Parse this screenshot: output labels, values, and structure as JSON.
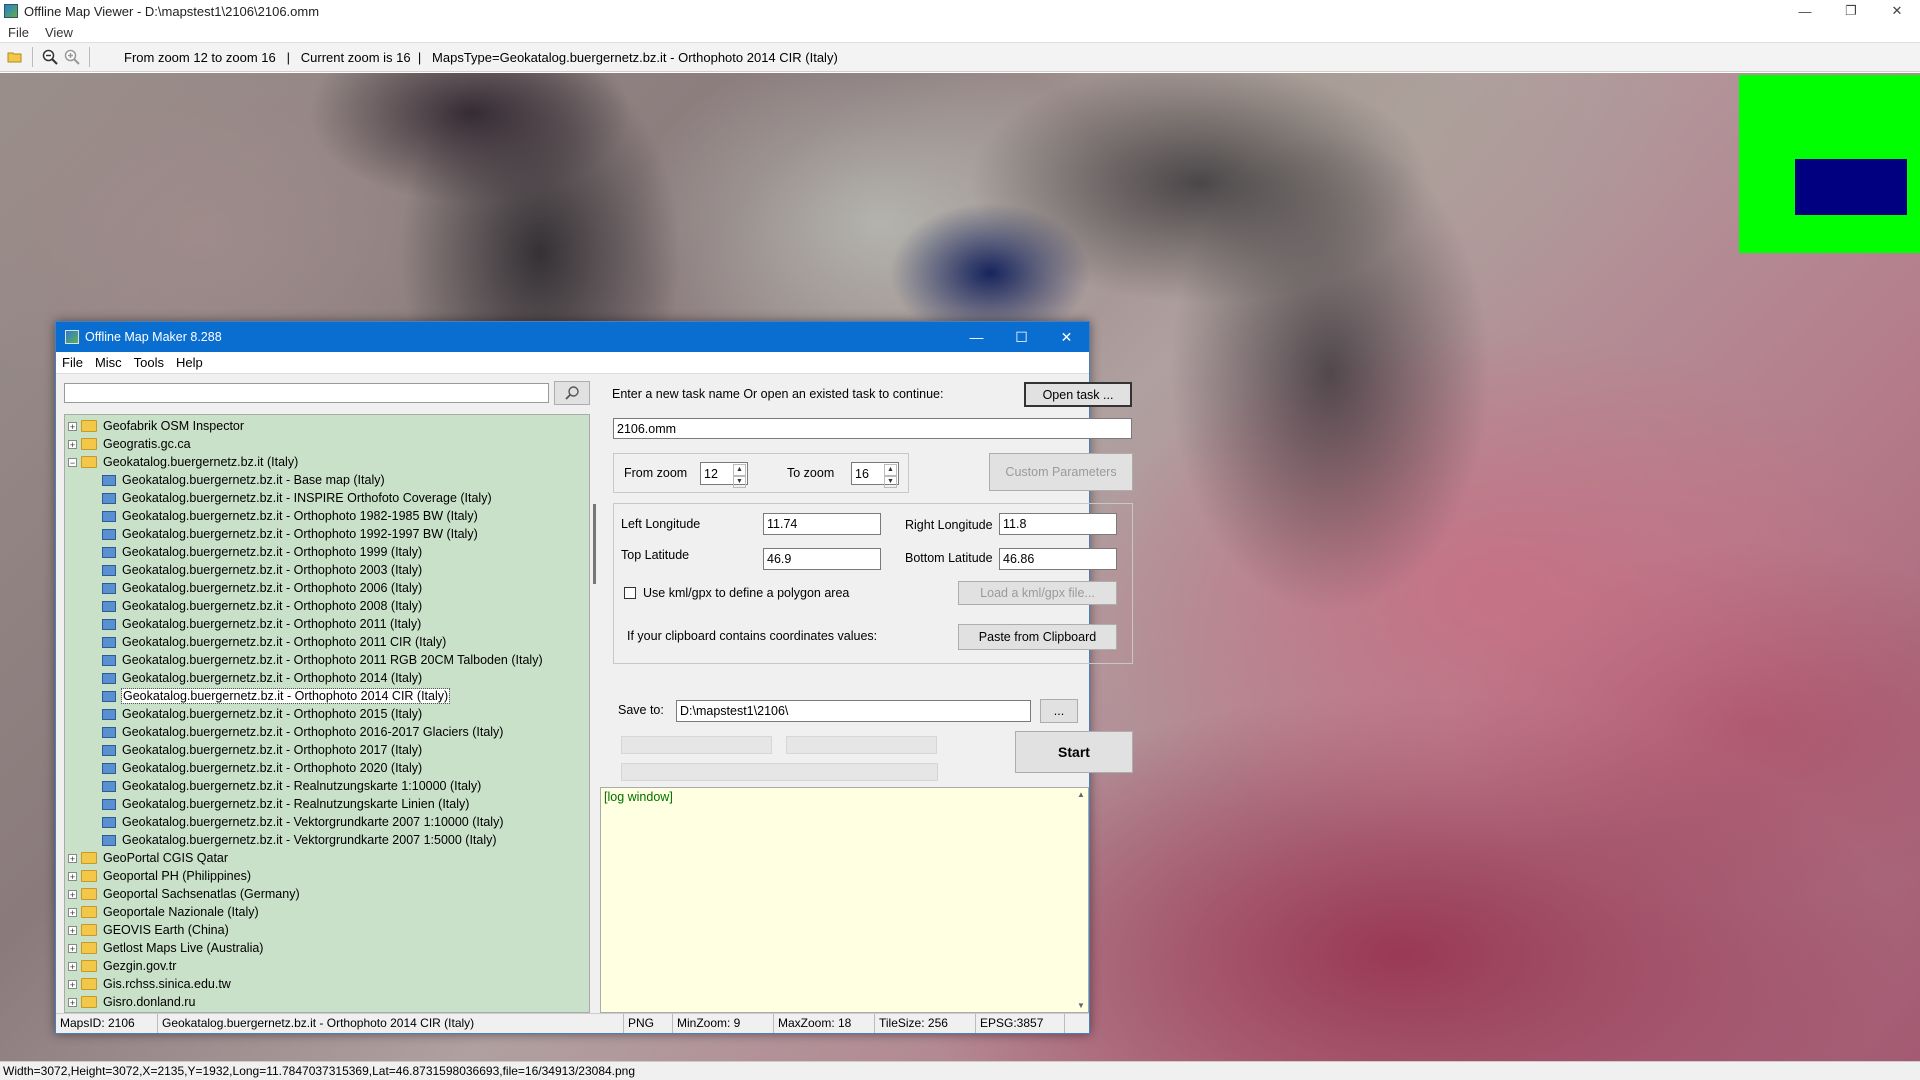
{
  "viewer": {
    "title": "Offline Map Viewer - D:\\mapstest1\\2106\\2106.omm",
    "menu": [
      "File",
      "View"
    ],
    "window_controls": [
      "—",
      "❐",
      "✕"
    ],
    "toolbar": {
      "status_text": "From zoom 12 to zoom 16   |   Current zoom is 16  |   MapsType=Geokatalog.buergernetz.bz.it - Orthophoto 2014 CIR (Italy)"
    },
    "statusbar": "Width=3072,Height=3072,X=2135,Y=1932,Long=11.7847037315369,Lat=46.8731598036693,file=16/34913/23084.png"
  },
  "colors": {
    "minimap_bg": "#00ff00",
    "minimap_view": "#000080",
    "dialog_title": "#0a6ed1",
    "tree_bg": "#c9e0c9",
    "log_bg": "#ffffe1"
  },
  "maker": {
    "title": "Offline Map Maker 8.288",
    "window_controls": [
      "—",
      "☐",
      "✕"
    ],
    "menu": [
      "File",
      "Misc",
      "Tools",
      "Help"
    ],
    "search": {
      "value": ""
    },
    "tree": [
      {
        "label": "Geofabrik OSM Inspector",
        "type": "folder",
        "expander": "+"
      },
      {
        "label": "Geogratis.gc.ca",
        "type": "folder",
        "expander": "+"
      },
      {
        "label": "Geokatalog.buergernetz.bz.it (Italy)",
        "type": "folder-open",
        "expander": "−"
      },
      {
        "label": "Geokatalog.buergernetz.bz.it - Base map (Italy)",
        "type": "map"
      },
      {
        "label": "Geokatalog.buergernetz.bz.it - INSPIRE Orthofoto Coverage (Italy)",
        "type": "map"
      },
      {
        "label": "Geokatalog.buergernetz.bz.it - Orthophoto 1982-1985 BW (Italy)",
        "type": "map"
      },
      {
        "label": "Geokatalog.buergernetz.bz.it - Orthophoto 1992-1997 BW (Italy)",
        "type": "map"
      },
      {
        "label": "Geokatalog.buergernetz.bz.it - Orthophoto 1999 (Italy)",
        "type": "map"
      },
      {
        "label": "Geokatalog.buergernetz.bz.it - Orthophoto 2003 (Italy)",
        "type": "map"
      },
      {
        "label": "Geokatalog.buergernetz.bz.it - Orthophoto 2006 (Italy)",
        "type": "map"
      },
      {
        "label": "Geokatalog.buergernetz.bz.it - Orthophoto 2008 (Italy)",
        "type": "map"
      },
      {
        "label": "Geokatalog.buergernetz.bz.it - Orthophoto 2011 (Italy)",
        "type": "map"
      },
      {
        "label": "Geokatalog.buergernetz.bz.it - Orthophoto 2011 CIR (Italy)",
        "type": "map"
      },
      {
        "label": "Geokatalog.buergernetz.bz.it - Orthophoto 2011 RGB 20CM Talboden (Italy)",
        "type": "map"
      },
      {
        "label": "Geokatalog.buergernetz.bz.it - Orthophoto 2014 (Italy)",
        "type": "map"
      },
      {
        "label": "Geokatalog.buergernetz.bz.it - Orthophoto 2014 CIR (Italy)",
        "type": "map",
        "selected": true
      },
      {
        "label": "Geokatalog.buergernetz.bz.it - Orthophoto 2015 (Italy)",
        "type": "map"
      },
      {
        "label": "Geokatalog.buergernetz.bz.it - Orthophoto 2016-2017 Glaciers (Italy)",
        "type": "map"
      },
      {
        "label": "Geokatalog.buergernetz.bz.it - Orthophoto 2017 (Italy)",
        "type": "map"
      },
      {
        "label": "Geokatalog.buergernetz.bz.it - Orthophoto 2020 (Italy)",
        "type": "map"
      },
      {
        "label": "Geokatalog.buergernetz.bz.it - Realnutzungskarte 1:10000 (Italy)",
        "type": "map"
      },
      {
        "label": "Geokatalog.buergernetz.bz.it - Realnutzungskarte Linien (Italy)",
        "type": "map"
      },
      {
        "label": "Geokatalog.buergernetz.bz.it - Vektorgrundkarte 2007 1:10000 (Italy)",
        "type": "map"
      },
      {
        "label": "Geokatalog.buergernetz.bz.it - Vektorgrundkarte 2007 1:5000 (Italy)",
        "type": "map"
      },
      {
        "label": "GeoPortal CGIS Qatar",
        "type": "folder",
        "expander": "+"
      },
      {
        "label": "Geoportal PH (Philippines)",
        "type": "folder",
        "expander": "+"
      },
      {
        "label": "Geoportal Sachsenatlas (Germany)",
        "type": "folder",
        "expander": "+"
      },
      {
        "label": "Geoportale Nazionale (Italy)",
        "type": "folder",
        "expander": "+"
      },
      {
        "label": "GEOVIS Earth (China)",
        "type": "folder",
        "expander": "+"
      },
      {
        "label": "Getlost Maps Live (Australia)",
        "type": "folder",
        "expander": "+"
      },
      {
        "label": "Gezgin.gov.tr",
        "type": "folder",
        "expander": "+"
      },
      {
        "label": "Gis.rchss.sinica.edu.tw",
        "type": "folder",
        "expander": "+"
      },
      {
        "label": "Gisro.donland.ru",
        "type": "folder",
        "expander": "+"
      }
    ],
    "task_prompt": "Enter a new task name Or open an existed task to continue:",
    "open_task_label": "Open task ...",
    "task_name": "2106.omm",
    "from_zoom_label": "From zoom",
    "from_zoom": "12",
    "to_zoom_label": "To zoom",
    "to_zoom": "16",
    "custom_params_label": "Custom Parameters",
    "left_lon_label": "Left Longitude",
    "left_lon": "11.74",
    "right_lon_label": "Right Longitude",
    "right_lon": "11.8",
    "top_lat_label": "Top Latitude",
    "top_lat": "46.9",
    "bottom_lat_label": "Bottom Latitude",
    "bottom_lat": "46.86",
    "kml_checkbox_label": "Use kml/gpx to define a polygon area",
    "kml_checked": false,
    "load_kml_label": "Load a kml/gpx file...",
    "clipboard_prompt": "If your clipboard contains coordinates values:",
    "paste_label": "Paste from Clipboard",
    "save_to_label": "Save to:",
    "save_to": "D:\\mapstest1\\2106\\",
    "browse_label": "...",
    "start_label": "Start",
    "log_text": "[log window]",
    "status": {
      "maps_id": "MapsID: 2106",
      "maps_name": "Geokatalog.buergernetz.bz.it - Orthophoto 2014 CIR (Italy)",
      "format": "PNG",
      "min_zoom": "MinZoom: 9",
      "max_zoom": "MaxZoom: 18",
      "tile_size": "TileSize: 256",
      "epsg": "EPSG:3857"
    }
  }
}
